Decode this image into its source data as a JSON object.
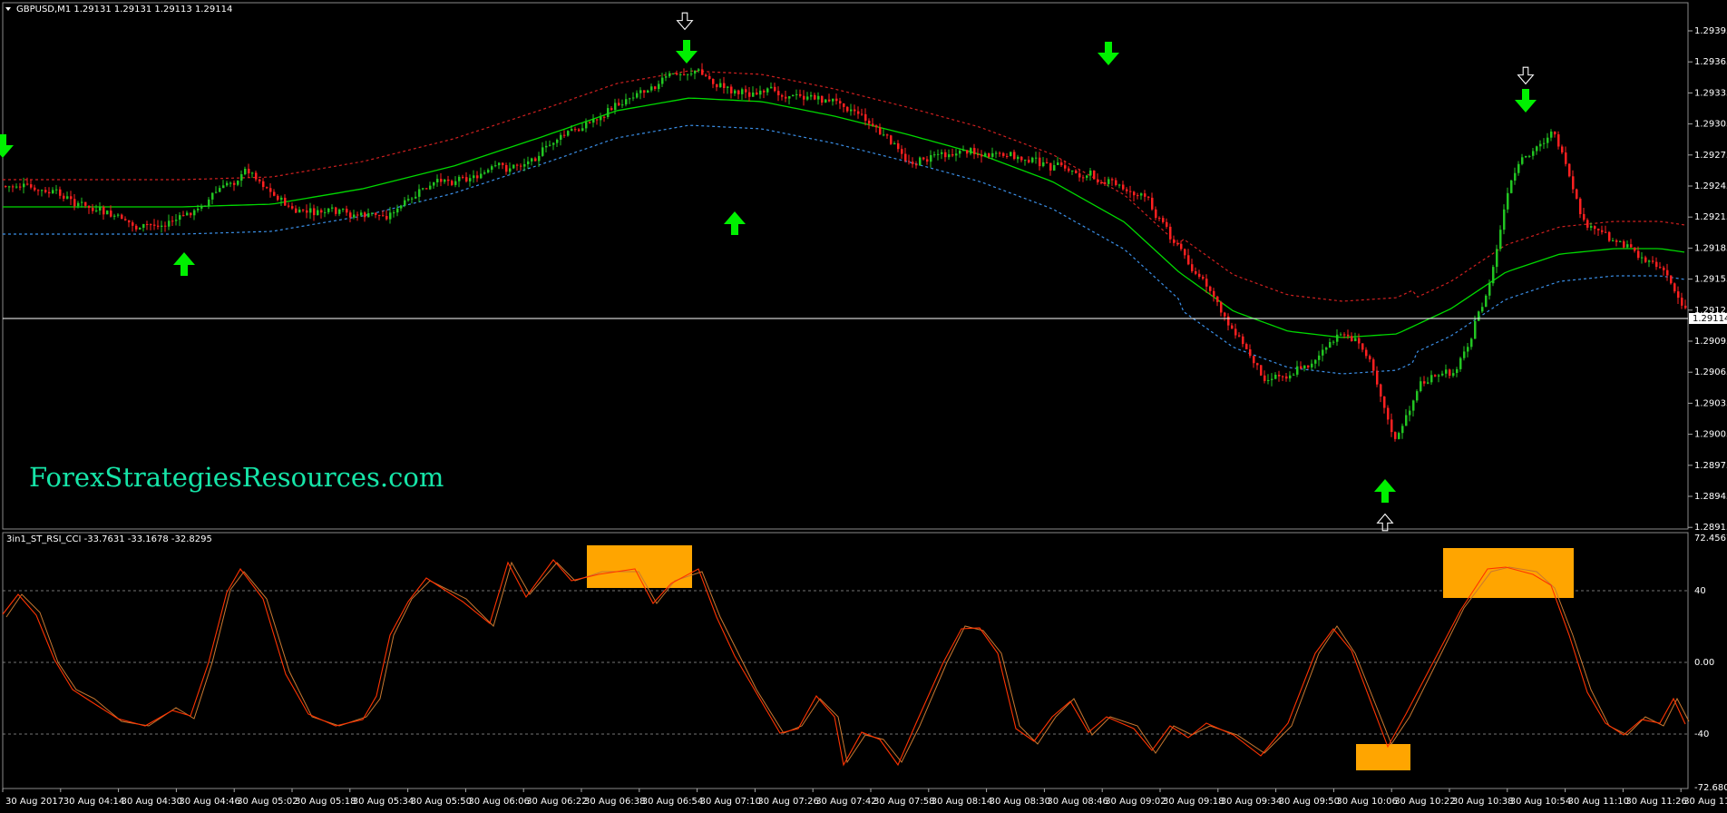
{
  "price_pane": {
    "title": "GBPUSD,M1  1.29131 1.29131 1.29113 1.29114",
    "current_price": "1.29114",
    "y_ticks": [
      "1.29395",
      "1.29365",
      "1.29335",
      "1.29305",
      "1.29275",
      "1.29245",
      "1.29215",
      "1.29185",
      "1.29155",
      "1.29125",
      "1.29095",
      "1.29065",
      "1.29035",
      "1.29005",
      "1.28975",
      "1.28945",
      "1.28915"
    ],
    "watermark": "ForexStrategiesResources.com"
  },
  "indicator_pane": {
    "title": "3in1_ST_RSI_CCI -33.7631 -33.1678 -32.8295",
    "y_ticks": [
      "72.4567",
      "40",
      "0.00",
      "-40",
      "-72.6806"
    ]
  },
  "x_ticks": [
    "30 Aug 2017",
    "30 Aug 04:14",
    "30 Aug 04:30",
    "30 Aug 04:46",
    "30 Aug 05:02",
    "30 Aug 05:18",
    "30 Aug 05:34",
    "30 Aug 05:50",
    "30 Aug 06:06",
    "30 Aug 06:22",
    "30 Aug 06:38",
    "30 Aug 06:54",
    "30 Aug 07:10",
    "30 Aug 07:26",
    "30 Aug 07:42",
    "30 Aug 07:58",
    "30 Aug 08:14",
    "30 Aug 08:30",
    "30 Aug 08:46",
    "30 Aug 09:02",
    "30 Aug 09:18",
    "30 Aug 09:34",
    "30 Aug 09:50",
    "30 Aug 10:06",
    "30 Aug 10:22",
    "30 Aug 10:38",
    "30 Aug 10:54",
    "30 Aug 11:10",
    "30 Aug 11:26",
    "30 Aug 11:"
  ],
  "colors": {
    "bull": "#22c522",
    "bear": "#ff2020",
    "midline": "#00d800",
    "upper_band": "#d02020",
    "lower_band": "#3a8ee6",
    "signal_arrow": "#00f000",
    "highlight_box": "#ffa500",
    "osc_main": "#ff3300",
    "osc_signal": "#c87830"
  }
}
